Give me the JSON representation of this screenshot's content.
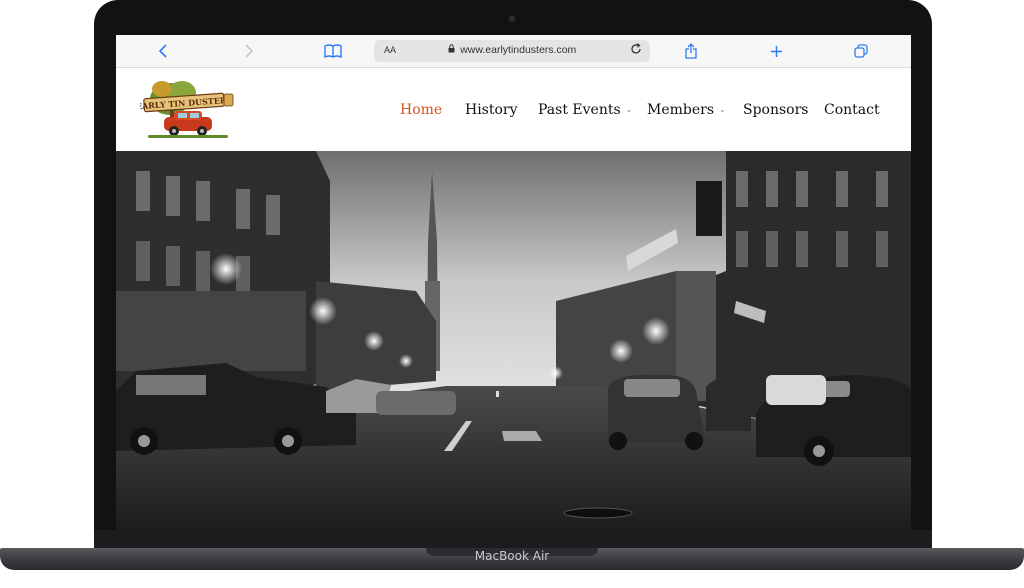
{
  "device": {
    "label": "MacBook Air"
  },
  "browser": {
    "url": "www.earlytindusters.com",
    "reader_label": "AA",
    "icons": [
      "back-icon",
      "forward-icon",
      "bookmarks-icon",
      "lock-icon",
      "reload-icon",
      "share-icon",
      "new-tab-icon",
      "tabs-icon"
    ]
  },
  "site": {
    "logo_text": "EARLY TIN DUSTERS",
    "nav": [
      {
        "label": "Home",
        "active": true
      },
      {
        "label": "History"
      },
      {
        "label": "Past Events",
        "dropdown": true
      },
      {
        "label": "Members",
        "dropdown": true
      },
      {
        "label": "Sponsors"
      },
      {
        "label": "Contact"
      }
    ],
    "colors": {
      "accent": "#d0541a",
      "browser_accent": "#2f7cf6"
    }
  }
}
